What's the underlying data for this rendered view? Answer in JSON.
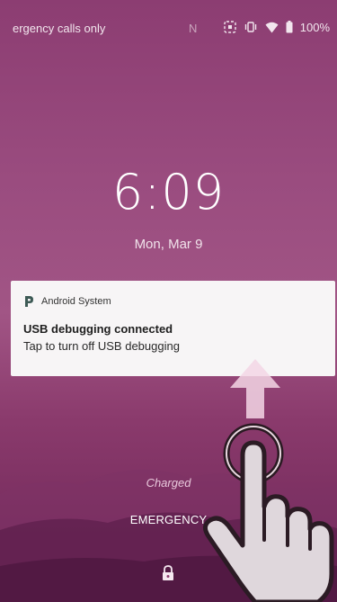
{
  "statusbar": {
    "carrier": "ergency calls only",
    "nfc_label": "N",
    "battery": "100%",
    "icons": [
      "nfc-icon",
      "vibrate-icon",
      "wifi-icon",
      "battery-icon"
    ]
  },
  "lockscreen": {
    "time": "6:09",
    "date": "Mon, Mar 9",
    "charge_status": "Charged",
    "emergency_label": "EMERGENCY",
    "lock_icon": "lock-icon"
  },
  "notification": {
    "app_name": "Android System",
    "title": "USB debugging connected",
    "body": "Tap to turn off USB debugging"
  },
  "overlay": {
    "hint": "swipe-up",
    "icons": [
      "arrow-up-icon",
      "hand-pointer-icon"
    ]
  },
  "colors": {
    "background_top": "#8c3d72",
    "background_bottom": "#6b2455",
    "notification_bg": "#f7f5f6",
    "app_icon": "#3d5a55"
  }
}
